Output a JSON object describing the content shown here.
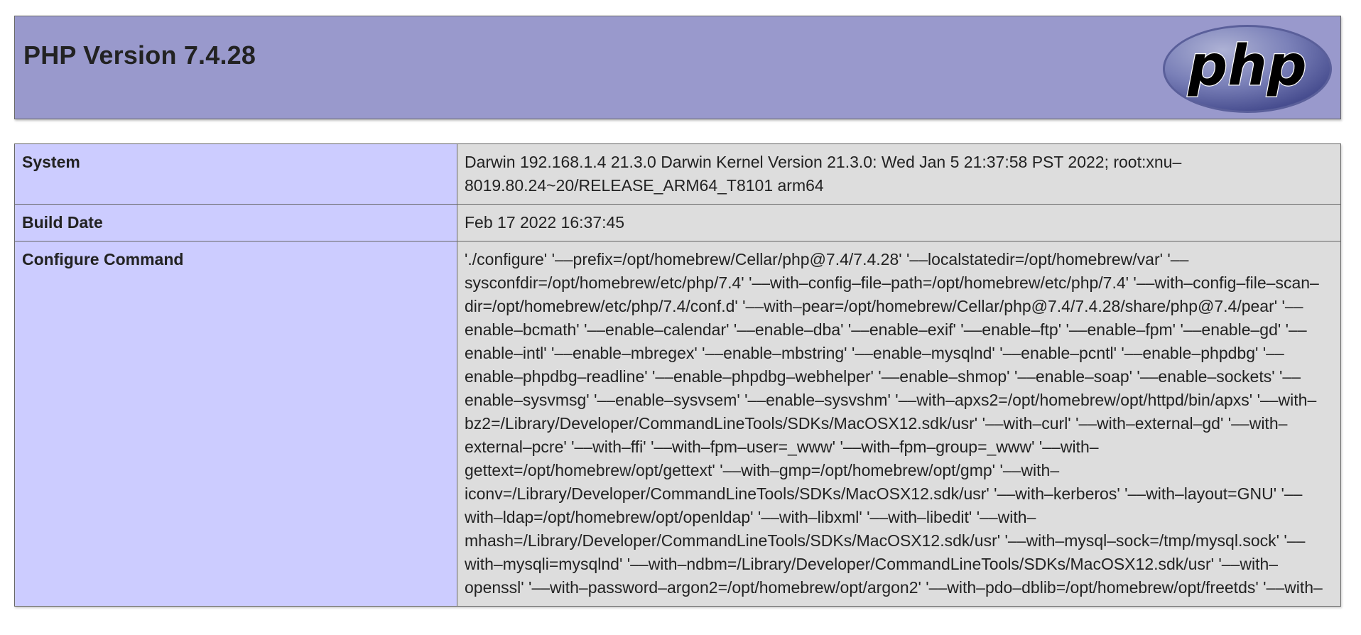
{
  "header": {
    "title": "PHP Version 7.4.28",
    "logo_text": "php",
    "logo_icon": "php-logo-icon"
  },
  "rows": [
    {
      "label": "System",
      "value": "Darwin 192.168.1.4 21.3.0 Darwin Kernel Version 21.3.0: Wed Jan 5 21:37:58 PST 2022; root:xnu–8019.80.24~20/RELEASE_ARM64_T8101 arm64"
    },
    {
      "label": "Build Date",
      "value": "Feb 17 2022 16:37:45"
    },
    {
      "label": "Configure Command",
      "value": "'./configure' '––prefix=/opt/homebrew/Cellar/php@7.4/7.4.28' '––localstatedir=/opt/homebrew/var' '––sysconfdir=/opt/homebrew/etc/php/7.4' '––with–config–file–path=/opt/homebrew/etc/php/7.4' '––with–config–file–scan–dir=/opt/homebrew/etc/php/7.4/conf.d' '––with–pear=/opt/homebrew/Cellar/php@7.4/7.4.28/share/php@7.4/pear' '––enable–bcmath' '––enable–calendar' '––enable–dba' '––enable–exif' '––enable–ftp' '––enable–fpm' '––enable–gd' '––enable–intl' '––enable–mbregex' '––enable–mbstring' '––enable–mysqlnd' '––enable–pcntl' '––enable–phpdbg' '––enable–phpdbg–readline' '––enable–phpdbg–webhelper' '––enable–shmop' '––enable–soap' '––enable–sockets' '––enable–sysvmsg' '––enable–sysvsem' '––enable–sysvshm' '––with–apxs2=/opt/homebrew/opt/httpd/bin/apxs' '––with–bz2=/Library/Developer/CommandLineTools/SDKs/MacOSX12.sdk/usr' '––with–curl' '––with–external–gd' '––with–external–pcre' '––with–ffi' '––with–fpm–user=_www' '––with–fpm–group=_www' '––with–gettext=/opt/homebrew/opt/gettext' '––with–gmp=/opt/homebrew/opt/gmp' '––with–iconv=/Library/Developer/CommandLineTools/SDKs/MacOSX12.sdk/usr' '––with–kerberos' '––with–layout=GNU' '––with–ldap=/opt/homebrew/opt/openldap' '––with–libxml' '––with–libedit' '––with–mhash=/Library/Developer/CommandLineTools/SDKs/MacOSX12.sdk/usr' '––with–mysql–sock=/tmp/mysql.sock' '––with–mysqli=mysqlnd' '––with–ndbm=/Library/Developer/CommandLineTools/SDKs/MacOSX12.sdk/usr' '––with–openssl' '––with–password–argon2=/opt/homebrew/opt/argon2' '––with–pdo–dblib=/opt/homebrew/opt/freetds' '––with–"
    }
  ],
  "colors": {
    "header_bg": "#9999cc",
    "label_bg": "#ccccff",
    "value_bg": "#dddddd",
    "border": "#666666"
  }
}
